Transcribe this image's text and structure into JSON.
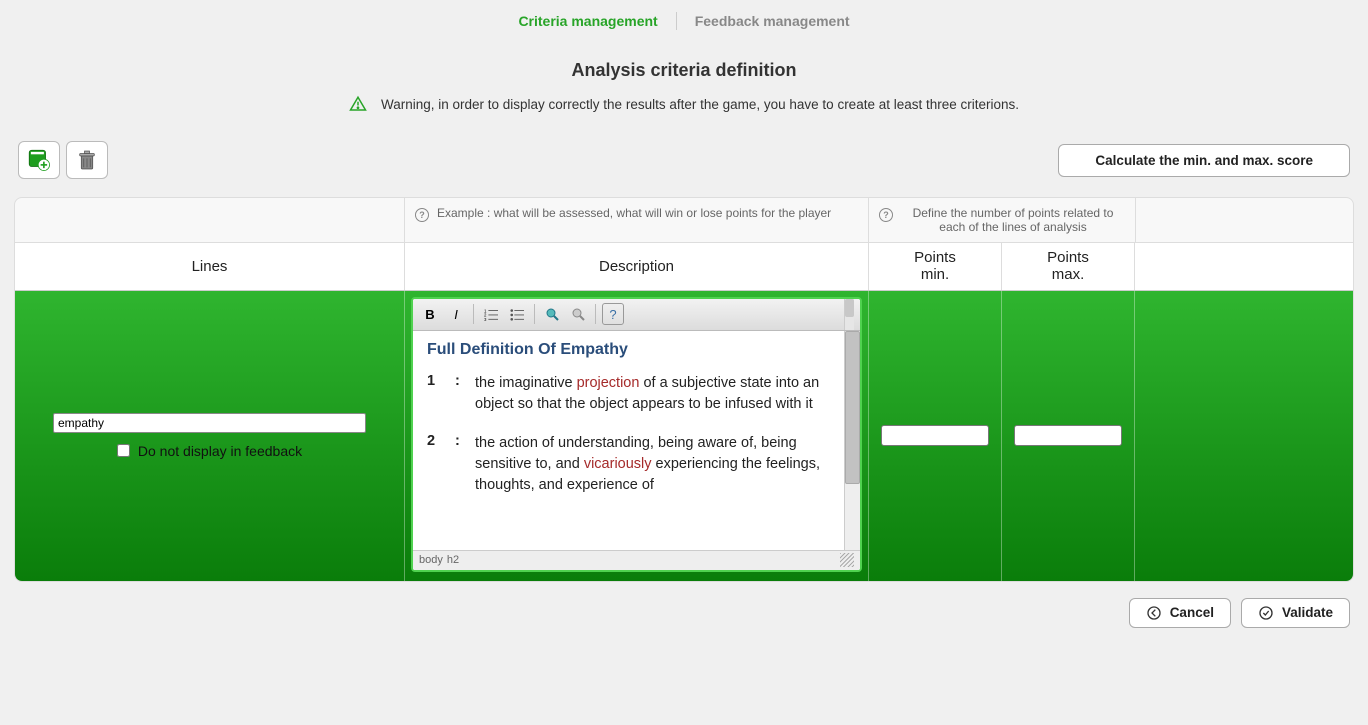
{
  "tabs": {
    "criteria": "Criteria management",
    "feedback": "Feedback management"
  },
  "page_title": "Analysis criteria definition",
  "warning_text": "Warning, in order to display correctly the results after the game, you have to create at least three criterions.",
  "calc_button": "Calculate the min. and max. score",
  "hints": {
    "description": "Example : what will be assessed, what will win or lose points for the player",
    "points": "Define the number of points related to each of the lines of analysis"
  },
  "headers": {
    "lines": "Lines",
    "description": "Description",
    "points_min_a": "Points",
    "points_min_b": "min.",
    "points_max_a": "Points",
    "points_max_b": "max."
  },
  "row": {
    "line_value": "empathy",
    "no_display_label": "Do not display in feedback",
    "editor_heading": "Full Definition Of Empathy",
    "def1_num": "1",
    "def1_a": "the imaginative ",
    "def1_link": "projection",
    "def1_b": " of a subjective state into an object so that the object appears to be infused with it",
    "def2_num": "2",
    "def2_a": "the action of understanding, being aware of, being sensitive to, and ",
    "def2_link": "vicariously",
    "def2_b": " experiencing the feelings, thoughts, and experience of",
    "points_min": "",
    "points_max": ""
  },
  "editor_status": {
    "path1": "body",
    "path2": "h2"
  },
  "footer": {
    "cancel": "Cancel",
    "validate": "Validate"
  }
}
